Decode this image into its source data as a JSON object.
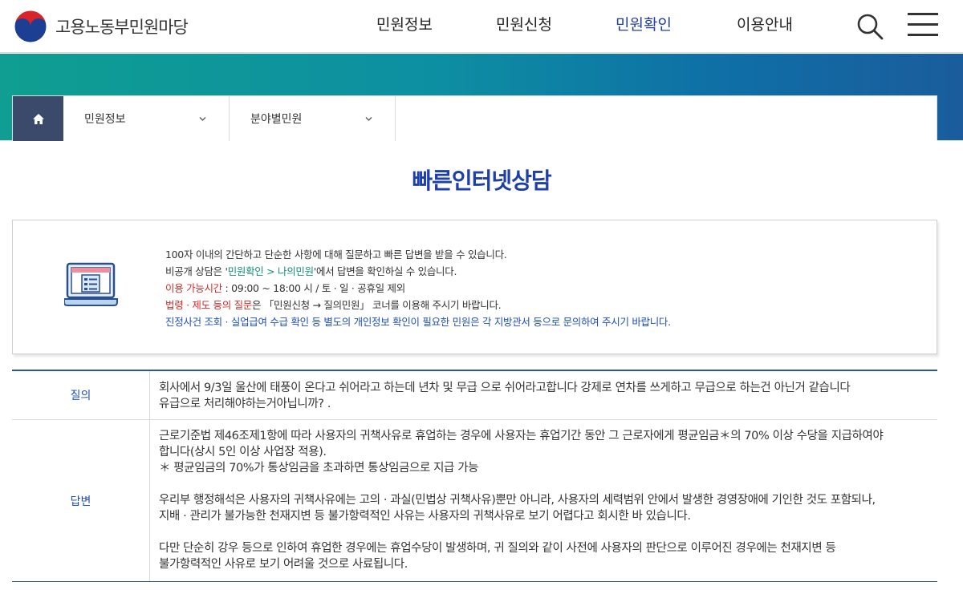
{
  "header": {
    "logo_text": "고용노동부민원마당",
    "nav": [
      {
        "label": "민원정보",
        "active": false
      },
      {
        "label": "민원신청",
        "active": false
      },
      {
        "label": "민원확인",
        "active": true
      },
      {
        "label": "이용안내",
        "active": false
      }
    ],
    "search_icon": "search-icon",
    "menu_icon": "hamburger-menu-icon"
  },
  "breadcrumb": {
    "home_icon": "home-icon",
    "items": [
      {
        "label": "민원정보"
      },
      {
        "label": "분야별민원"
      }
    ]
  },
  "page": {
    "title": "빠른인터넷상담"
  },
  "info": {
    "icon": "laptop-form-icon",
    "line1": "100자 이내의 간단하고 단순한 사항에 대해 질문하고 빠른 답변을 받을 수 있습니다.",
    "line2_prefix": "비공개 상담은 '",
    "line2_highlight": "민원확인 > 나의민원",
    "line2_suffix": "'에서 답변을 확인하실 수 있습니다.",
    "line3_highlight": "이용 가능시간",
    "line3_suffix": " : 09:00 ~ 18:00 시 / 토 · 일 · 공휴일 제외",
    "line4_highlight": "법령 · 제도 등의 질문",
    "line4_suffix": "은 「민원신청 → 질의민원」 코너를 이용해 주시기 바랍니다.",
    "line5": "진정사건 조회 · 실업급여 수급 확인 등 별도의 개인정보 확인이 필요한 민원은 각 지방관서 등으로 문의하여 주시기 바랍니다."
  },
  "qa": {
    "question_label": "질의",
    "question_lines": [
      "회사에서 9/3일 울산에 태풍이 온다고 쉬어라고 하는데 년차 및 무급 으로 쉬어라고합니다 강제로 연차를 쓰게하고 무급으로 하는건 아닌거 같습니다",
      "유급으로 처리해야하는거아닙니까? ."
    ],
    "answer_label": "답변",
    "answer_para1": [
      "근로기준법 제46조제1항에 따라 사용자의 귀책사유로 휴업하는 경우에 사용자는 휴업기간 동안 그 근로자에게 평균임금＊의 70% 이상 수당을 지급하여야",
      "합니다(상시 5인 이상 사업장 적용).",
      "＊ 평균임금의 70%가 통상임금을 초과하면 통상임금으로 지급 가능"
    ],
    "answer_para2": [
      "우리부 행정해석은 사용자의 귀책사유에는 고의 · 과실(민법상 귀책사유)뿐만 아니라, 사용자의 세력범위 안에서 발생한 경영장애에 기인한 것도 포함되나,",
      "지배 · 관리가 불가능한 천재지변 등 불가항력적인 사유는 사용자의 귀책사유로 보기 어렵다고 회시한 바 있습니다."
    ],
    "answer_para3": [
      "다만 단순히 강우 등으로 인하여 휴업한 경우에는 휴업수당이 발생하며, 귀 질의와 같이 사전에 사용자의 판단으로 이루어진 경우에는 천재지변 등",
      "불가항력적인 사유로 보기 어려울 것으로 사료됩니다."
    ]
  },
  "colors": {
    "brand_blue": "#1e3ea8",
    "highlight_green": "#148d78",
    "highlight_red": "#d42a2a",
    "banner_teal": "#0f9e91",
    "breadcrumb_home_bg": "#3b4a6b"
  }
}
